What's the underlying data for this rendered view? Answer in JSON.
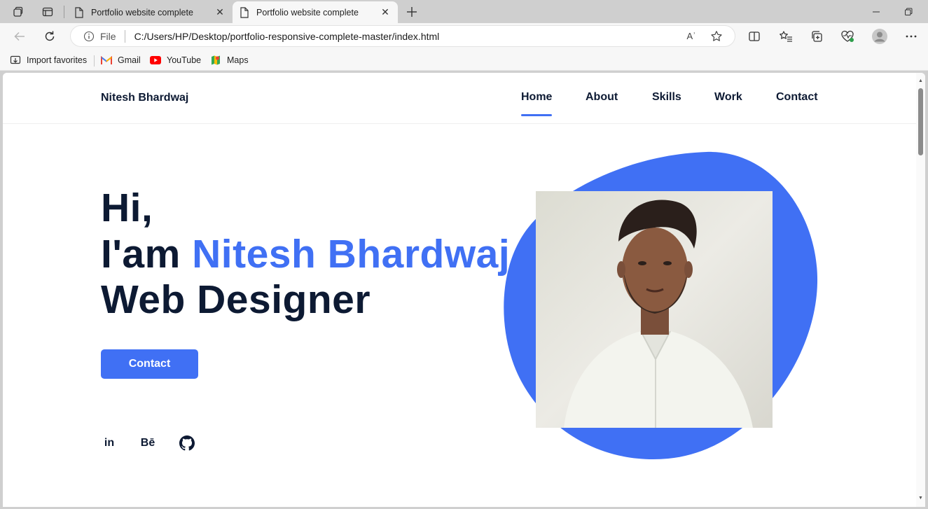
{
  "browser": {
    "tabs": [
      {
        "title": "Portfolio website complete",
        "active": false
      },
      {
        "title": "Portfolio website complete",
        "active": true
      }
    ],
    "close_glyph": "✕",
    "address": {
      "scheme_label": "File",
      "url": "C:/Users/HP/Desktop/portfolio-responsive-complete-master/index.html"
    },
    "favorites": [
      {
        "label": "Import favorites",
        "icon": "import-icon"
      },
      {
        "label": "Gmail",
        "icon": "gmail-icon"
      },
      {
        "label": "YouTube",
        "icon": "youtube-icon"
      },
      {
        "label": "Maps",
        "icon": "maps-icon"
      }
    ],
    "read_aloud_glyph": "Aʾ"
  },
  "site": {
    "logo": "Nitesh Bhardwaj",
    "nav": [
      {
        "label": "Home",
        "active": true
      },
      {
        "label": "About",
        "active": false
      },
      {
        "label": "Skills",
        "active": false
      },
      {
        "label": "Work",
        "active": false
      },
      {
        "label": "Contact",
        "active": false
      }
    ],
    "hero": {
      "greeting": "Hi,",
      "intro": "I'am ",
      "name": "Nitesh Bhardwaj",
      "role": "Web Designer"
    },
    "cta_label": "Contact",
    "social": [
      {
        "label": "in",
        "icon": "linkedin-icon"
      },
      {
        "label": "Bē",
        "icon": "behance-icon"
      },
      {
        "label": "",
        "icon": "github-icon"
      }
    ],
    "colors": {
      "accent": "#4070f4",
      "text": "#0d1a33"
    }
  }
}
